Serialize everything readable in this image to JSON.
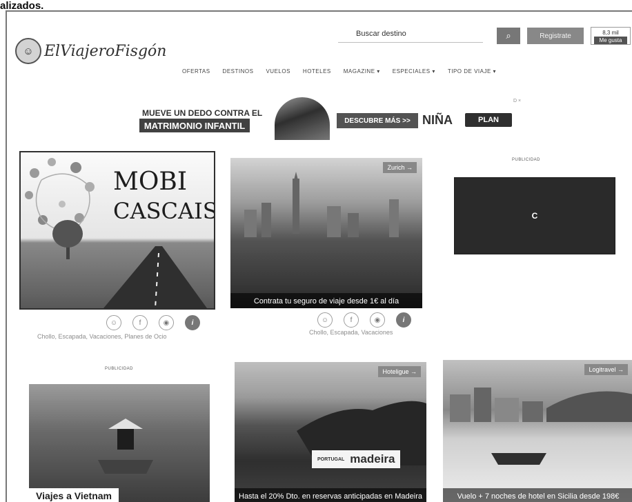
{
  "page_caption": "alizados.",
  "header": {
    "logo_icon": "face-icon",
    "logo_text": "ElViajeroFisgón",
    "search_placeholder": "Buscar destino",
    "search_button_icon": "search-icon",
    "register_label": "Registrate",
    "like_count": "8,3 mil",
    "like_label": "Me gusta"
  },
  "nav": [
    "OFERTAS",
    "DESTINOS",
    "VUELOS",
    "HOTELES",
    "MAGAZINE ▾",
    "ESPECIALES ▾",
    "TIPO DE VIAJE ▾"
  ],
  "banner": {
    "line1": "MUEVE UN DEDO CONTRA EL",
    "line2": "MATRIMONIO INFANTIL",
    "cta": "DESCUBRE MÁS >>",
    "nina": "NIÑA",
    "plan": "PLAN",
    "adchoice": "D ×"
  },
  "cards": [
    {
      "title_line1": "MOBI",
      "title_line2": "CASCAIS",
      "meta": "Chollo, Escapada, Vacaciones, Planes de Ocio"
    },
    {
      "tag": "Zurich →",
      "overlay": "Contrata tu seguro de viaje desde 1€ al día",
      "meta": "Chollo, Escapada, Vacaciones"
    },
    {
      "pub_label": "PUBLICIDAD",
      "ad_letter": "C"
    }
  ],
  "row2": [
    {
      "pub_label": "PUBLICIDAD",
      "ad_title": "Viajes a Vietnam"
    },
    {
      "tag": "Hoteligue →",
      "logo_left": "PORTUGAL",
      "logo_right": "madeira",
      "overlay": "Hasta el 20% Dto. en reservas anticipadas en Madeira"
    },
    {
      "tag": "Logitravel →",
      "overlay": "Vuelo + 7 noches de hotel en Sicilia desde 198€"
    }
  ],
  "share_icons": [
    "smile-icon",
    "facebook-icon",
    "reddit-icon",
    "info-icon"
  ]
}
